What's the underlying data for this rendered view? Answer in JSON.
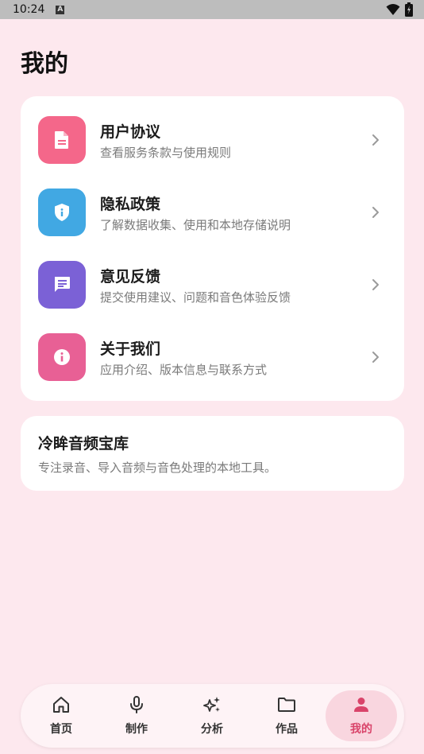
{
  "status_bar": {
    "time": "10:24",
    "indicator": "A",
    "icons": [
      "wifi-icon",
      "battery-icon"
    ]
  },
  "page": {
    "title": "我的"
  },
  "menu": [
    {
      "title": "用户协议",
      "subtitle": "查看服务条款与使用规则",
      "icon": "document-icon",
      "color": "#f4678a"
    },
    {
      "title": "隐私政策",
      "subtitle": "了解数据收集、使用和本地存储说明",
      "icon": "shield-icon",
      "color": "#41a8e3"
    },
    {
      "title": "意见反馈",
      "subtitle": "提交使用建议、问题和音色体验反馈",
      "icon": "feedback-icon",
      "color": "#7b61d6"
    },
    {
      "title": "关于我们",
      "subtitle": "应用介绍、版本信息与联系方式",
      "icon": "info-icon",
      "color": "#e86095"
    }
  ],
  "about": {
    "title": "冷眸音频宝库",
    "description": "专注录音、导入音频与音色处理的本地工具。"
  },
  "bottom_nav": {
    "items": [
      {
        "label": "首页",
        "icon": "home-icon"
      },
      {
        "label": "制作",
        "icon": "microphone-icon"
      },
      {
        "label": "分析",
        "icon": "sparkle-icon"
      },
      {
        "label": "作品",
        "icon": "folder-icon"
      },
      {
        "label": "我的",
        "icon": "person-icon"
      }
    ],
    "active": "我的"
  },
  "colors": {
    "background": "#fde8ee",
    "accent": "#d9446a",
    "active_pill": "#f9d6df"
  }
}
